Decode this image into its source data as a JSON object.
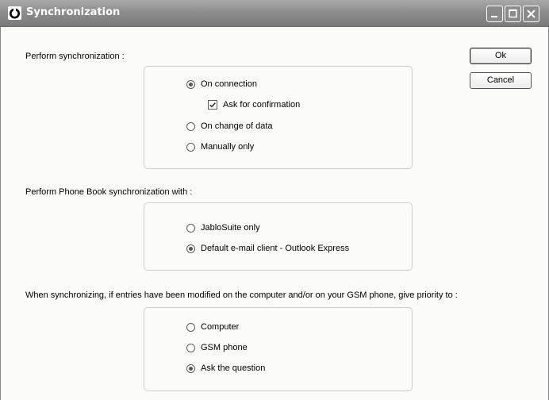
{
  "window": {
    "title": "Synchronization"
  },
  "buttons": {
    "ok": "Ok",
    "cancel": "Cancel"
  },
  "sync": {
    "label": "Perform synchronization :",
    "options": [
      {
        "label": "On connection",
        "selected": true
      },
      {
        "label": "On change of data",
        "selected": false
      },
      {
        "label": "Manually only",
        "selected": false
      }
    ],
    "confirm": {
      "label": "Ask for confirmation",
      "checked": true
    }
  },
  "phonebook": {
    "label": "Perform Phone Book synchronization with :",
    "options": [
      {
        "label": "JabloSuite only",
        "selected": false
      },
      {
        "label": "Default e-mail client - Outlook Express",
        "selected": true
      }
    ]
  },
  "priority": {
    "label": "When synchronizing, if entries have been modified on the computer and/or on your GSM phone, give priority to :",
    "options": [
      {
        "label": "Computer",
        "selected": false
      },
      {
        "label": "GSM phone",
        "selected": false
      },
      {
        "label": "Ask the question",
        "selected": true
      }
    ]
  }
}
